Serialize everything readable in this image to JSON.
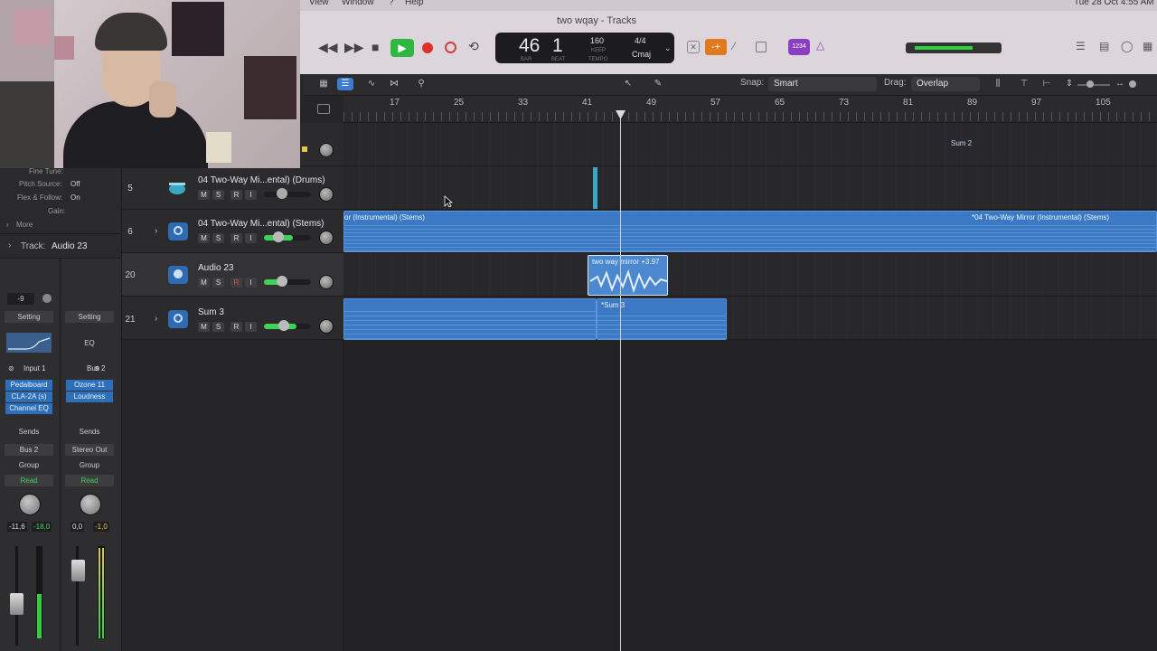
{
  "menubar": {
    "items": [
      "View",
      "Window",
      "?",
      "Help"
    ],
    "clock": "Tue 28 Oct  4:55 AM"
  },
  "window": {
    "title": "two wqay - Tracks"
  },
  "lcd": {
    "bar": "46",
    "beat": "1",
    "bar_label": "BAR",
    "beat_label": "BEAT",
    "tempo": "160",
    "tempo_mode": "KEEP",
    "tempo_label": "TEMPO",
    "signature": "4/4",
    "key": "Cmaj"
  },
  "toolbar": {
    "count_in": "1234"
  },
  "subbar": {
    "snap_label": "Snap:",
    "snap_value": "Smart",
    "drag_label": "Drag:",
    "drag_value": "Overlap"
  },
  "ruler": {
    "marks": [
      "17",
      "25",
      "33",
      "41",
      "49",
      "57",
      "65",
      "73",
      "81",
      "89",
      "97",
      "105"
    ]
  },
  "inspector": {
    "fine_tune": "Fine Tune:",
    "pitch_source_label": "Pitch Source:",
    "pitch_source_value": "Off",
    "flex_label": "Flex & Follow:",
    "flex_value": "On",
    "gain_label": "Gain:",
    "more": "More",
    "track_label": "Track:",
    "track_value": "Audio 23",
    "gain_value": "-9",
    "ch1": {
      "setting": "Setting",
      "input": "Input 1",
      "plugins": [
        "Pedalboard",
        "CLA-2A (s)",
        "Channel EQ"
      ],
      "sends": "Sends",
      "output": "Bus 2",
      "group": "Group",
      "automation": "Read",
      "vol": "-11,6",
      "peak": "-18,0"
    },
    "ch2": {
      "setting": "Setting",
      "eq": "EQ",
      "input": "Bus 2",
      "plugins": [
        "Ozone 11",
        "Loudness"
      ],
      "sends": "Sends",
      "output": "Stereo Out",
      "group": "Group",
      "automation": "Read",
      "vol": "0,0",
      "peak": "-1,0"
    }
  },
  "tracks": [
    {
      "num": "5",
      "name": "04 Two-Way Mi...ental) (Drums)"
    },
    {
      "num": "6",
      "name": "04 Two-Way Mi...ental) (Stems)"
    },
    {
      "num": "20",
      "name": "Audio 23"
    },
    {
      "num": "21",
      "name": "Sum 3"
    }
  ],
  "track_buttons": {
    "m": "M",
    "s": "S",
    "r": "R",
    "i": "I"
  },
  "regions": {
    "sum2": "Sum 2",
    "stems_left": "or (Instrumental) (Stems)",
    "stems_right": "*04 Two-Way Mirror (Instrumental) (Stems)",
    "audio23": "two way mirror +3.97",
    "sum3": "*Sum 3"
  },
  "colors": {
    "accent_blue": "#3c79c4",
    "play_green": "#2fb83f",
    "record_red": "#e0302a"
  }
}
